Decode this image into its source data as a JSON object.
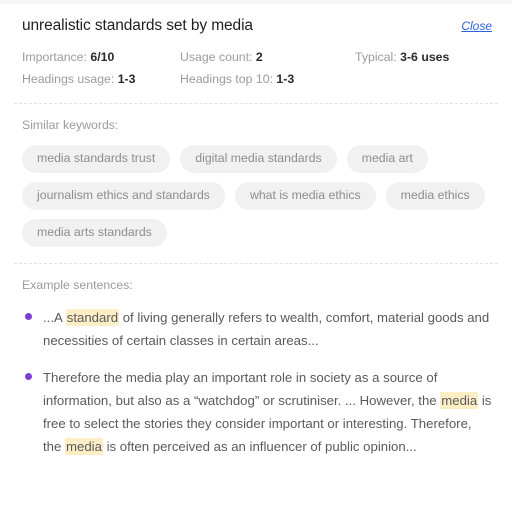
{
  "header": {
    "title": "unrealistic standards set by media",
    "close_label": "Close"
  },
  "stats": {
    "rows": [
      [
        {
          "label": "Importance:",
          "value": "6/10"
        },
        {
          "label": "Usage count:",
          "value": "2"
        },
        {
          "label": "Typical:",
          "value": "3-6 uses"
        }
      ],
      [
        {
          "label": "Headings usage:",
          "value": "1-3"
        },
        {
          "label": "Headings top 10:",
          "value": "1-3"
        }
      ]
    ]
  },
  "keywords": {
    "label": "Similar keywords:",
    "items": [
      "media standards trust",
      "digital media standards",
      "media art",
      "journalism ethics and standards",
      "what is media ethics",
      "media ethics",
      "media arts standards"
    ]
  },
  "examples": {
    "label": "Example sentences:",
    "items": [
      {
        "parts": [
          {
            "text": "...A ",
            "highlight": false
          },
          {
            "text": "standard",
            "highlight": true
          },
          {
            "text": " of living generally refers to wealth, comfort, material goods and necessities of certain classes in certain areas...",
            "highlight": false
          }
        ]
      },
      {
        "parts": [
          {
            "text": "Therefore the media play an important role in society as a source of information, but also as a “watchdog” or scrutiniser. ... However, the ",
            "highlight": false
          },
          {
            "text": "media",
            "highlight": true
          },
          {
            "text": " is free to select the stories they consider important or interesting. Therefore, the ",
            "highlight": false
          },
          {
            "text": "media",
            "highlight": true
          },
          {
            "text": " is often perceived as an influencer of public opinion...",
            "highlight": false
          }
        ]
      }
    ]
  },
  "colors": {
    "link": "#2b62d9",
    "bullet": "#7b3fd4",
    "highlight": "#fdeec6",
    "chip_bg": "#f1f1f1",
    "muted_text": "#9b9b9b"
  }
}
